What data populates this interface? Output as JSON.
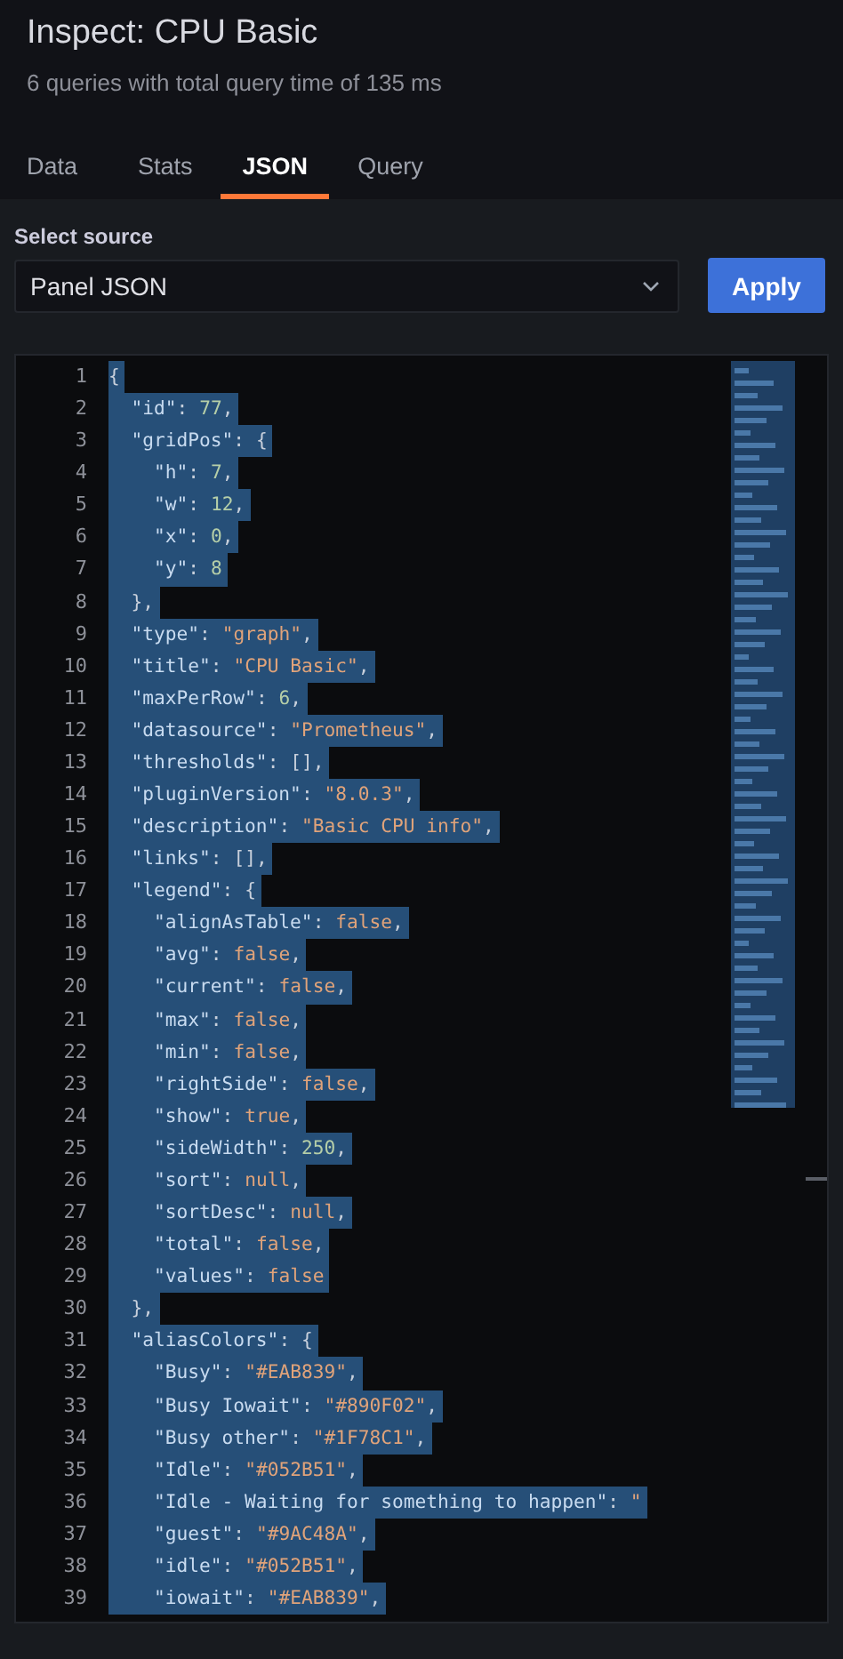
{
  "header": {
    "title": "Inspect: CPU Basic",
    "subtitle": "6 queries with total query time of 135 ms"
  },
  "tabs": [
    {
      "label": "Data",
      "selected": false
    },
    {
      "label": "Stats",
      "selected": false
    },
    {
      "label": "JSON",
      "selected": true
    },
    {
      "label": "Query",
      "selected": false
    }
  ],
  "source": {
    "label": "Select source",
    "value": "Panel JSON"
  },
  "apply_button": "Apply",
  "editor": {
    "all_selected": true,
    "lines": [
      {
        "number": "1",
        "text": "{"
      },
      {
        "number": "2",
        "text": "  \"id\": 77,"
      },
      {
        "number": "3",
        "text": "  \"gridPos\": {"
      },
      {
        "number": "4",
        "text": "    \"h\": 7,"
      },
      {
        "number": "5",
        "text": "    \"w\": 12,"
      },
      {
        "number": "6",
        "text": "    \"x\": 0,"
      },
      {
        "number": "7",
        "text": "    \"y\": 8"
      },
      {
        "number": "8",
        "text": "  },"
      },
      {
        "number": "9",
        "text": "  \"type\": \"graph\","
      },
      {
        "number": "10",
        "text": "  \"title\": \"CPU Basic\","
      },
      {
        "number": "11",
        "text": "  \"maxPerRow\": 6,"
      },
      {
        "number": "12",
        "text": "  \"datasource\": \"Prometheus\","
      },
      {
        "number": "13",
        "text": "  \"thresholds\": [],"
      },
      {
        "number": "14",
        "text": "  \"pluginVersion\": \"8.0.3\","
      },
      {
        "number": "15",
        "text": "  \"description\": \"Basic CPU info\","
      },
      {
        "number": "16",
        "text": "  \"links\": [],"
      },
      {
        "number": "17",
        "text": "  \"legend\": {"
      },
      {
        "number": "18",
        "text": "    \"alignAsTable\": false,"
      },
      {
        "number": "19",
        "text": "    \"avg\": false,"
      },
      {
        "number": "20",
        "text": "    \"current\": false,"
      },
      {
        "number": "21",
        "text": "    \"max\": false,"
      },
      {
        "number": "22",
        "text": "    \"min\": false,"
      },
      {
        "number": "23",
        "text": "    \"rightSide\": false,"
      },
      {
        "number": "24",
        "text": "    \"show\": true,"
      },
      {
        "number": "25",
        "text": "    \"sideWidth\": 250,"
      },
      {
        "number": "26",
        "text": "    \"sort\": null,"
      },
      {
        "number": "27",
        "text": "    \"sortDesc\": null,"
      },
      {
        "number": "28",
        "text": "    \"total\": false,"
      },
      {
        "number": "29",
        "text": "    \"values\": false"
      },
      {
        "number": "30",
        "text": "  },"
      },
      {
        "number": "31",
        "text": "  \"aliasColors\": {"
      },
      {
        "number": "32",
        "text": "    \"Busy\": \"#EAB839\","
      },
      {
        "number": "33",
        "text": "    \"Busy Iowait\": \"#890F02\","
      },
      {
        "number": "34",
        "text": "    \"Busy other\": \"#1F78C1\","
      },
      {
        "number": "35",
        "text": "    \"Idle\": \"#052B51\","
      },
      {
        "number": "36",
        "text": "    \"Idle - Waiting for something to happen\": \""
      },
      {
        "number": "37",
        "text": "    \"guest\": \"#9AC48A\","
      },
      {
        "number": "38",
        "text": "    \"idle\": \"#052B51\","
      },
      {
        "number": "39",
        "text": "    \"iowait\": \"#EAB839\","
      }
    ]
  }
}
